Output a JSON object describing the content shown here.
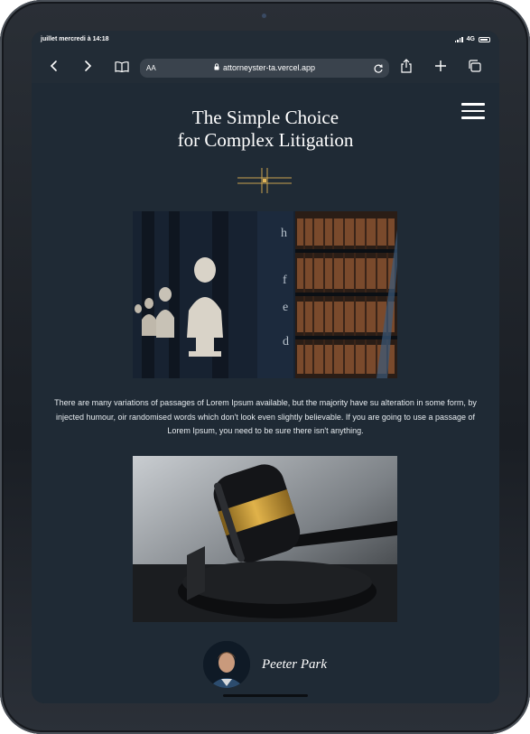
{
  "status_bar": {
    "time": "juillet mercredi à 14:18",
    "network": "4G"
  },
  "browser": {
    "text_size_label": "AA",
    "url": "attorneyster-ta.vercel.app"
  },
  "hero": {
    "title_line1": "The Simple Choice",
    "title_line2": "for Complex Litigation"
  },
  "library_photo": {
    "book_spine_letters": [
      "h",
      "f",
      "e",
      "d"
    ]
  },
  "intro": {
    "text": "There are many variations of passages of Lorem Ipsum available, but the majority have su alteration in some form, by injected humour, oir randomised words which don't look even slightly believable. If you are going to use a passage of Lorem Ipsum, you need to be sure there isn't anything."
  },
  "author": {
    "name": "Peeter Park"
  },
  "colors": {
    "page_background": "#1f2a35",
    "accent_gold": "#c9a34e",
    "text": "#ffffff"
  }
}
